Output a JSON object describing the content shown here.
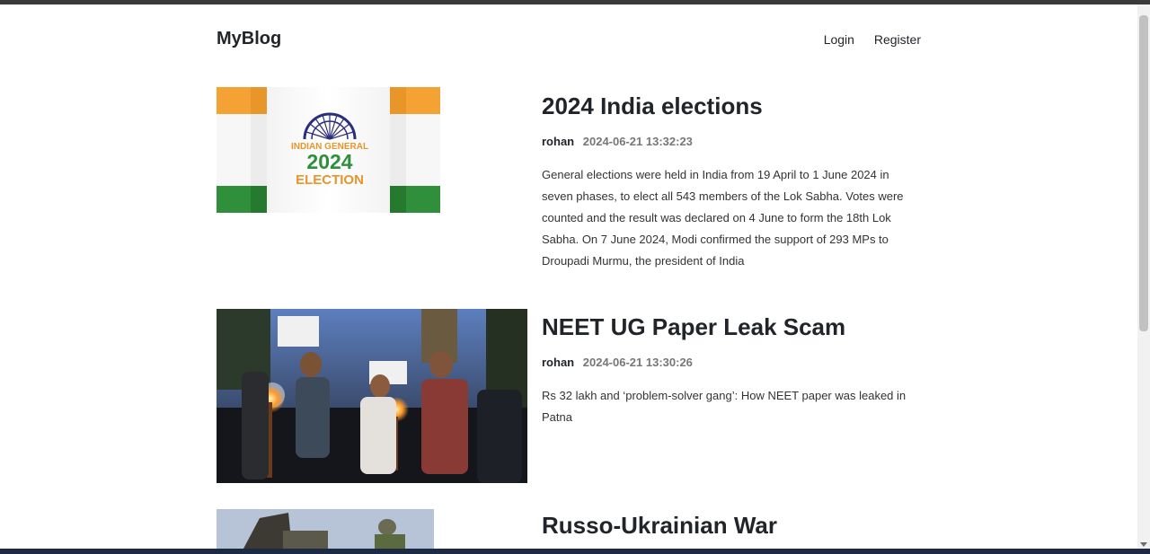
{
  "brand": "MyBlog",
  "nav": {
    "login": "Login",
    "register": "Register"
  },
  "posts": [
    {
      "title": "2024 India elections",
      "author": "rohan",
      "date": "2024-06-21 13:32:23",
      "excerpt": "General elections were held in India from 19 April to 1 June 2024 in seven phases, to elect all 543 members of the Lok Sabha. Votes were counted and the result was declared on 4 June to form the 18th Lok Sabha. On 7 June 2024, Modi confirmed the support of 293 MPs to Droupadi Murmu, the president of India",
      "image": {
        "line1": "INDIAN GENERAL",
        "line2": "2024",
        "line3": "ELECTION"
      }
    },
    {
      "title": "NEET UG Paper Leak Scam",
      "author": "rohan",
      "date": "2024-06-21 13:30:26",
      "excerpt": "Rs 32 lakh and ‘problem-solver gang’: How NEET paper was leaked in Patna"
    },
    {
      "title": "Russo-Ukrainian War"
    }
  ],
  "colors": {
    "saffron": "#f4a233",
    "green": "#2f8f3a",
    "navy": "#2b2e7a",
    "text": "#212529",
    "muted": "#777777"
  }
}
